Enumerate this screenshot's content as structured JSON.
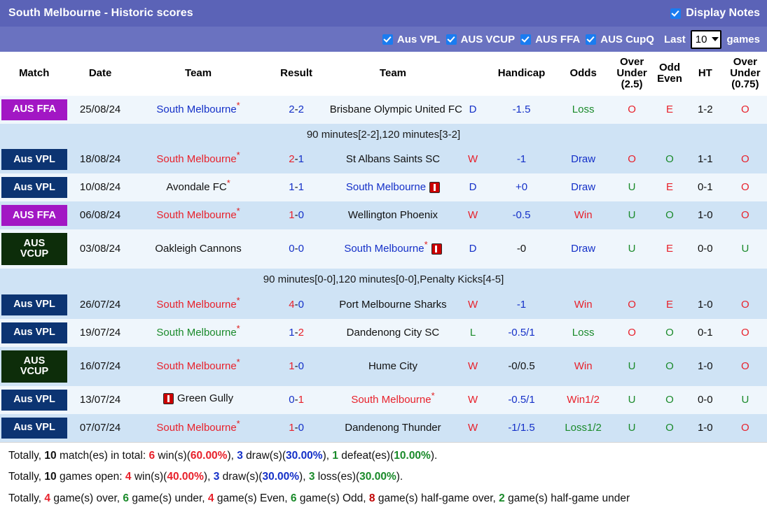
{
  "header": {
    "title": "South Melbourne - Historic scores",
    "display_notes_label": "Display Notes",
    "display_notes_checked": true
  },
  "filters": {
    "leagues": [
      {
        "label": "Aus VPL",
        "checked": true
      },
      {
        "label": "AUS VCUP",
        "checked": true
      },
      {
        "label": "AUS FFA",
        "checked": true
      },
      {
        "label": "AUS CupQ",
        "checked": true
      }
    ],
    "last_label": "Last",
    "games_label": "games",
    "games_value": "10"
  },
  "columns": {
    "match": "Match",
    "date": "Date",
    "team1": "Team",
    "result": "Result",
    "team2": "Team",
    "wdl": "",
    "handicap": "Handicap",
    "odds": "Odds",
    "over_under_25_l1": "Over",
    "over_under_25_l2": "Under",
    "over_under_25_l3": "(2.5)",
    "odd_even_l1": "Odd",
    "odd_even_l2": "Even",
    "ht": "HT",
    "over_under_075_l1": "Over",
    "over_under_075_l2": "Under",
    "over_under_075_l3": "(0.75)"
  },
  "rows": [
    {
      "badge": "AUS FFA",
      "badge_type": "ffa",
      "badge_lines": 1,
      "date": "25/08/24",
      "team1": "South Melbourne",
      "team1_star": true,
      "team1_card": false,
      "team1_color": "blue",
      "score_home": "2",
      "score_sep": "-",
      "score_away": "2",
      "score_home_color": "blue",
      "score_away_color": "blue",
      "team2": "Brisbane Olympic United FC",
      "team2_star": false,
      "team2_card": false,
      "team2_color": "black",
      "wdl": "D",
      "wdl_color": "blue",
      "handicap": "-1.5",
      "handicap_color": "blue",
      "odds": "Loss",
      "odds_color": "green",
      "ou25": "O",
      "ou25_color": "red",
      "oddeven": "E",
      "oddeven_color": "red",
      "ht": "1-2",
      "ou075": "O",
      "ou075_color": "red",
      "note": "90 minutes[2-2],120 minutes[3-2]"
    },
    {
      "badge": "Aus VPL",
      "badge_type": "vpl",
      "badge_lines": 1,
      "date": "18/08/24",
      "team1": "South Melbourne",
      "team1_star": true,
      "team1_card": false,
      "team1_color": "red",
      "score_home": "2",
      "score_sep": "-",
      "score_away": "1",
      "score_home_color": "red",
      "score_away_color": "blue",
      "team2": "St Albans Saints SC",
      "team2_star": false,
      "team2_card": false,
      "team2_color": "black",
      "wdl": "W",
      "wdl_color": "red",
      "handicap": "-1",
      "handicap_color": "blue",
      "odds": "Draw",
      "odds_color": "blue",
      "ou25": "O",
      "ou25_color": "red",
      "oddeven": "O",
      "oddeven_color": "green",
      "ht": "1-1",
      "ou075": "O",
      "ou075_color": "red",
      "note": null
    },
    {
      "badge": "Aus VPL",
      "badge_type": "vpl",
      "badge_lines": 1,
      "date": "10/08/24",
      "team1": "Avondale FC",
      "team1_star": true,
      "team1_card": false,
      "team1_color": "black",
      "score_home": "1",
      "score_sep": "-",
      "score_away": "1",
      "score_home_color": "blue",
      "score_away_color": "blue",
      "team2": "South Melbourne",
      "team2_star": false,
      "team2_card": true,
      "team2_color": "blue",
      "wdl": "D",
      "wdl_color": "blue",
      "handicap": "+0",
      "handicap_color": "blue",
      "odds": "Draw",
      "odds_color": "blue",
      "ou25": "U",
      "ou25_color": "green",
      "oddeven": "E",
      "oddeven_color": "red",
      "ht": "0-1",
      "ou075": "O",
      "ou075_color": "red",
      "note": null
    },
    {
      "badge": "AUS FFA",
      "badge_type": "ffa",
      "badge_lines": 1,
      "date": "06/08/24",
      "team1": "South Melbourne",
      "team1_star": true,
      "team1_card": false,
      "team1_color": "red",
      "score_home": "1",
      "score_sep": "-",
      "score_away": "0",
      "score_home_color": "red",
      "score_away_color": "blue",
      "team2": "Wellington Phoenix",
      "team2_star": false,
      "team2_card": false,
      "team2_color": "black",
      "wdl": "W",
      "wdl_color": "red",
      "handicap": "-0.5",
      "handicap_color": "blue",
      "odds": "Win",
      "odds_color": "red",
      "ou25": "U",
      "ou25_color": "green",
      "oddeven": "O",
      "oddeven_color": "green",
      "ht": "1-0",
      "ou075": "O",
      "ou075_color": "red",
      "note": null
    },
    {
      "badge": "AUS VCUP",
      "badge_type": "vcup",
      "badge_lines": 2,
      "date": "03/08/24",
      "team1": "Oakleigh Cannons",
      "team1_star": false,
      "team1_card": false,
      "team1_color": "black",
      "score_home": "0",
      "score_sep": "-",
      "score_away": "0",
      "score_home_color": "blue",
      "score_away_color": "blue",
      "team2": "South Melbourne",
      "team2_star": true,
      "team2_card": true,
      "team2_color": "blue",
      "wdl": "D",
      "wdl_color": "blue",
      "handicap": "-0",
      "handicap_color": "black",
      "odds": "Draw",
      "odds_color": "blue",
      "ou25": "U",
      "ou25_color": "green",
      "oddeven": "E",
      "oddeven_color": "red",
      "ht": "0-0",
      "ou075": "U",
      "ou075_color": "green",
      "note": "90 minutes[0-0],120 minutes[0-0],Penalty Kicks[4-5]"
    },
    {
      "badge": "Aus VPL",
      "badge_type": "vpl",
      "badge_lines": 1,
      "date": "26/07/24",
      "team1": "South Melbourne",
      "team1_star": true,
      "team1_card": false,
      "team1_color": "red",
      "score_home": "4",
      "score_sep": "-",
      "score_away": "0",
      "score_home_color": "red",
      "score_away_color": "blue",
      "team2": "Port Melbourne Sharks",
      "team2_star": false,
      "team2_card": false,
      "team2_color": "black",
      "wdl": "W",
      "wdl_color": "red",
      "handicap": "-1",
      "handicap_color": "blue",
      "odds": "Win",
      "odds_color": "red",
      "ou25": "O",
      "ou25_color": "red",
      "oddeven": "E",
      "oddeven_color": "red",
      "ht": "1-0",
      "ou075": "O",
      "ou075_color": "red",
      "note": null
    },
    {
      "badge": "Aus VPL",
      "badge_type": "vpl",
      "badge_lines": 1,
      "date": "19/07/24",
      "team1": "South Melbourne",
      "team1_star": true,
      "team1_card": false,
      "team1_color": "green",
      "score_home": "1",
      "score_sep": "-",
      "score_away": "2",
      "score_home_color": "blue",
      "score_away_color": "red",
      "team2": "Dandenong City SC",
      "team2_star": false,
      "team2_card": false,
      "team2_color": "black",
      "wdl": "L",
      "wdl_color": "green",
      "handicap": "-0.5/1",
      "handicap_color": "blue",
      "odds": "Loss",
      "odds_color": "green",
      "ou25": "O",
      "ou25_color": "red",
      "oddeven": "O",
      "oddeven_color": "green",
      "ht": "0-1",
      "ou075": "O",
      "ou075_color": "red",
      "note": null
    },
    {
      "badge": "AUS VCUP",
      "badge_type": "vcup",
      "badge_lines": 2,
      "date": "16/07/24",
      "team1": "South Melbourne",
      "team1_star": true,
      "team1_card": false,
      "team1_color": "red",
      "score_home": "1",
      "score_sep": "-",
      "score_away": "0",
      "score_home_color": "red",
      "score_away_color": "blue",
      "team2": "Hume City",
      "team2_star": false,
      "team2_card": false,
      "team2_color": "black",
      "wdl": "W",
      "wdl_color": "red",
      "handicap": "-0/0.5",
      "handicap_color": "black",
      "odds": "Win",
      "odds_color": "red",
      "ou25": "U",
      "ou25_color": "green",
      "oddeven": "O",
      "oddeven_color": "green",
      "ht": "1-0",
      "ou075": "O",
      "ou075_color": "red",
      "note": null
    },
    {
      "badge": "Aus VPL",
      "badge_type": "vpl",
      "badge_lines": 1,
      "date": "13/07/24",
      "team1": "Green Gully",
      "team1_star": false,
      "team1_card": true,
      "team1_card_before": true,
      "team1_color": "black",
      "score_home": "0",
      "score_sep": "-",
      "score_away": "1",
      "score_home_color": "blue",
      "score_away_color": "red",
      "team2": "South Melbourne",
      "team2_star": true,
      "team2_card": false,
      "team2_color": "red",
      "wdl": "W",
      "wdl_color": "red",
      "handicap": "-0.5/1",
      "handicap_color": "blue",
      "odds": "Win1/2",
      "odds_color": "red",
      "ou25": "U",
      "ou25_color": "green",
      "oddeven": "O",
      "oddeven_color": "green",
      "ht": "0-0",
      "ou075": "U",
      "ou075_color": "green",
      "note": null
    },
    {
      "badge": "Aus VPL",
      "badge_type": "vpl",
      "badge_lines": 1,
      "date": "07/07/24",
      "team1": "South Melbourne",
      "team1_star": true,
      "team1_card": false,
      "team1_color": "red",
      "score_home": "1",
      "score_sep": "-",
      "score_away": "0",
      "score_home_color": "red",
      "score_away_color": "blue",
      "team2": "Dandenong Thunder",
      "team2_star": false,
      "team2_card": false,
      "team2_color": "black",
      "wdl": "W",
      "wdl_color": "red",
      "handicap": "-1/1.5",
      "handicap_color": "blue",
      "odds": "Loss1/2",
      "odds_color": "green",
      "ou25": "U",
      "ou25_color": "green",
      "oddeven": "O",
      "oddeven_color": "green",
      "ht": "1-0",
      "ou075": "O",
      "ou075_color": "red",
      "note": null
    }
  ],
  "summary": {
    "line1": {
      "p1": "Totally, ",
      "n_total": "10",
      "p2": " match(es) in total: ",
      "n_win": "6",
      "p3": " win(s)(",
      "pct_win": "60.00%",
      "p4": "), ",
      "n_draw": "3",
      "p5": " draw(s)(",
      "pct_draw": "30.00%",
      "p6": "), ",
      "n_def": "1",
      "p7": " defeat(es)(",
      "pct_def": "10.00%",
      "p8": ")."
    },
    "line2": {
      "p1": "Totally, ",
      "n_total": "10",
      "p2": " games open: ",
      "n_win": "4",
      "p3": " win(s)(",
      "pct_win": "40.00%",
      "p4": "), ",
      "n_draw": "3",
      "p5": " draw(s)(",
      "pct_draw": "30.00%",
      "p6": "), ",
      "n_loss": "3",
      "p7": " loss(es)(",
      "pct_loss": "30.00%",
      "p8": ")."
    },
    "line3": {
      "p1": "Totally, ",
      "n_over": "4",
      "p2": " game(s) over, ",
      "n_under": "6",
      "p3": " game(s) under, ",
      "n_even": "4",
      "p4": " game(s) Even, ",
      "n_odd": "6",
      "p5": " game(s) Odd, ",
      "n_hgo": "8",
      "p6": " game(s) half-game over, ",
      "n_hgu": "2",
      "p7": " game(s) half-game under"
    }
  },
  "colors": {
    "title_bar": "#5b63b7",
    "filter_bar": "#6a72c0",
    "badge_ffa": "#a217c4",
    "badge_vpl": "#0c3472",
    "badge_vcup": "#0d2d0a",
    "row_odd": "#eff6fc",
    "row_even": "#cfe3f5",
    "win_red": "#e8212b",
    "draw_blue": "#1430c8",
    "loss_green": "#1a8a2a"
  }
}
